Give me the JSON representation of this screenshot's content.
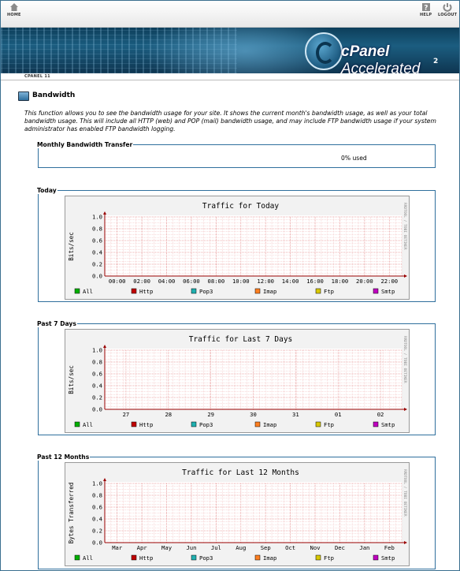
{
  "topbar": {
    "home_label": "HOME",
    "help_label": "HELP",
    "logout_label": "LOGOUT"
  },
  "banner": {
    "logo_text": "cPanel",
    "logo_text2": "Accelerated",
    "logo_sub": "2"
  },
  "breadcrumb": "CPANEL 11",
  "page": {
    "title": "Bandwidth",
    "description": "This function allows you to see the bandwidth usage for your site. It shows the current month's bandwidth usage, as well as your total bandwidth usage. This will include all HTTP (web) and POP (mail) bandwidth usage, and may include FTP bandwidth usage if your system administrator has enabled FTP bandwidth logging."
  },
  "monthly": {
    "legend": "Monthly Bandwidth Transfer",
    "usage": "0% used"
  },
  "colors": {
    "frame": "#2f6f9d",
    "grid": "#f0b8b8",
    "axis": "#990000"
  },
  "legend_items": [
    {
      "label": "All",
      "color": "#00b000"
    },
    {
      "label": "Http",
      "color": "#c00000"
    },
    {
      "label": "Pop3",
      "color": "#20b0b0"
    },
    {
      "label": "Imap",
      "color": "#ff7f20"
    },
    {
      "label": "Ftp",
      "color": "#d8c800"
    },
    {
      "label": "Smtp",
      "color": "#c000c0"
    }
  ],
  "side_label": "RRDTOOL / TOBI OETIKER",
  "sections": [
    {
      "legend": "Today",
      "chart_data": {
        "type": "line",
        "title": "Traffic for Today",
        "ylabel": "Bits/sec",
        "xlabel": "",
        "yticks": [
          "1.0",
          "0.8",
          "0.6",
          "0.4",
          "0.2",
          "0.0"
        ],
        "ylim": [
          0,
          1.0
        ],
        "xticks": [
          "00:00",
          "02:00",
          "04:00",
          "06:00",
          "08:00",
          "10:00",
          "12:00",
          "14:00",
          "16:00",
          "18:00",
          "20:00",
          "22:00"
        ],
        "series": [
          {
            "name": "All",
            "values": [
              0,
              0,
              0,
              0,
              0,
              0,
              0,
              0,
              0,
              0,
              0,
              0
            ]
          },
          {
            "name": "Http",
            "values": [
              0,
              0,
              0,
              0,
              0,
              0,
              0,
              0,
              0,
              0,
              0,
              0
            ]
          },
          {
            "name": "Pop3",
            "values": [
              0,
              0,
              0,
              0,
              0,
              0,
              0,
              0,
              0,
              0,
              0,
              0
            ]
          },
          {
            "name": "Imap",
            "values": [
              0,
              0,
              0,
              0,
              0,
              0,
              0,
              0,
              0,
              0,
              0,
              0
            ]
          },
          {
            "name": "Ftp",
            "values": [
              0,
              0,
              0,
              0,
              0,
              0,
              0,
              0,
              0,
              0,
              0,
              0
            ]
          },
          {
            "name": "Smtp",
            "values": [
              0,
              0,
              0,
              0,
              0,
              0,
              0,
              0,
              0,
              0,
              0,
              0
            ]
          }
        ]
      }
    },
    {
      "legend": "Past 7 Days",
      "chart_data": {
        "type": "line",
        "title": "Traffic for Last 7 Days",
        "ylabel": "Bits/sec",
        "xlabel": "",
        "yticks": [
          "1.0",
          "0.8",
          "0.6",
          "0.4",
          "0.2",
          "0.0"
        ],
        "ylim": [
          0,
          1.0
        ],
        "xticks": [
          "27",
          "28",
          "29",
          "30",
          "31",
          "01",
          "02"
        ],
        "series": [
          {
            "name": "All",
            "values": [
              0,
              0,
              0,
              0,
              0,
              0,
              0
            ]
          },
          {
            "name": "Http",
            "values": [
              0,
              0,
              0,
              0,
              0,
              0,
              0
            ]
          },
          {
            "name": "Pop3",
            "values": [
              0,
              0,
              0,
              0,
              0,
              0,
              0
            ]
          },
          {
            "name": "Imap",
            "values": [
              0,
              0,
              0,
              0,
              0,
              0,
              0
            ]
          },
          {
            "name": "Ftp",
            "values": [
              0,
              0,
              0,
              0,
              0,
              0,
              0
            ]
          },
          {
            "name": "Smtp",
            "values": [
              0,
              0,
              0,
              0,
              0,
              0,
              0
            ]
          }
        ]
      }
    },
    {
      "legend": "Past 12 Months",
      "chart_data": {
        "type": "line",
        "title": "Traffic for Last 12 Months",
        "ylabel": "Bytes Transferred",
        "xlabel": "",
        "yticks": [
          "1.0",
          "0.8",
          "0.6",
          "0.4",
          "0.2",
          "0.0"
        ],
        "ylim": [
          0,
          1.0
        ],
        "xticks": [
          "Mar",
          "Apr",
          "May",
          "Jun",
          "Jul",
          "Aug",
          "Sep",
          "Oct",
          "Nov",
          "Dec",
          "Jan",
          "Feb"
        ],
        "series": [
          {
            "name": "All",
            "values": [
              0,
              0,
              0,
              0,
              0,
              0,
              0,
              0,
              0,
              0,
              0,
              0
            ]
          },
          {
            "name": "Http",
            "values": [
              0,
              0,
              0,
              0,
              0,
              0,
              0,
              0,
              0,
              0,
              0,
              0
            ]
          },
          {
            "name": "Pop3",
            "values": [
              0,
              0,
              0,
              0,
              0,
              0,
              0,
              0,
              0,
              0,
              0,
              0
            ]
          },
          {
            "name": "Imap",
            "values": [
              0,
              0,
              0,
              0,
              0,
              0,
              0,
              0,
              0,
              0,
              0,
              0
            ]
          },
          {
            "name": "Ftp",
            "values": [
              0,
              0,
              0,
              0,
              0,
              0,
              0,
              0,
              0,
              0,
              0,
              0
            ]
          },
          {
            "name": "Smtp",
            "values": [
              0,
              0,
              0,
              0,
              0,
              0,
              0,
              0,
              0,
              0,
              0,
              0
            ]
          }
        ]
      }
    }
  ]
}
